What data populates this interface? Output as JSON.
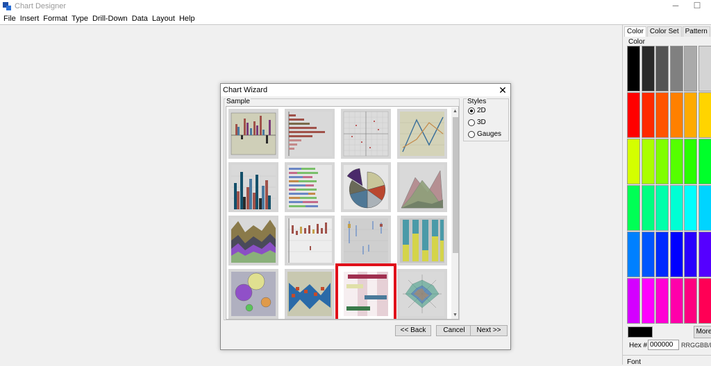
{
  "window": {
    "title": "Chart Designer"
  },
  "menu": [
    "File",
    "Insert",
    "Format",
    "Type",
    "Drill-Down",
    "Data",
    "Layout",
    "Help"
  ],
  "right_panel": {
    "tabs": [
      "Color",
      "Color Set",
      "Pattern"
    ],
    "active_tab": "Color",
    "section_label": "Color",
    "palette_rows": [
      [
        "#000000",
        "#2a2a2a",
        "#555555",
        "#808080",
        "#aaaaaa",
        "#d4d4d4"
      ],
      [
        "#ff0000",
        "#ff2a00",
        "#ff5500",
        "#ff8000",
        "#ffaa00",
        "#ffd400"
      ],
      [
        "#d4ff00",
        "#aaff00",
        "#80ff00",
        "#55ff00",
        "#2aff00",
        "#00ff2a"
      ],
      [
        "#00ff55",
        "#00ff80",
        "#00ffaa",
        "#00ffd4",
        "#00ffff",
        "#00d4ff"
      ],
      [
        "#0080ff",
        "#0055ff",
        "#002aff",
        "#0000ff",
        "#2a00ff",
        "#5500ff"
      ],
      [
        "#d400ff",
        "#ff00ff",
        "#ff00d4",
        "#ff00aa",
        "#ff0080",
        "#ff0055"
      ]
    ],
    "current_color": "#000000",
    "more_label": "More",
    "hex_label": "Hex #",
    "hex_value": "000000",
    "hex_format": "RRGGBB/RGI",
    "font_label": "Font"
  },
  "dialog": {
    "title": "Chart Wizard",
    "sample_label": "Sample",
    "styles_label": "Styles",
    "styles": [
      "2D",
      "3D",
      "Gauges"
    ],
    "selected_style": "2D",
    "buttons": {
      "back": "<< Back",
      "cancel": "Cancel",
      "next": "Next >>"
    },
    "thumbnails": [
      "bar-chart",
      "horizontal-bar-chart",
      "scatter-chart",
      "line-chart",
      "stacked-bar-chart",
      "stacked-horizontal-bar-chart",
      "pie-chart",
      "area-chart",
      "stacked-area-chart",
      "hilo-chart",
      "candlestick-chart",
      "stacked-100-bar-chart",
      "bubble-chart",
      "overlay-chart",
      "gantt-chart",
      "radar-chart"
    ],
    "selected_thumbnail": "gantt-chart"
  }
}
